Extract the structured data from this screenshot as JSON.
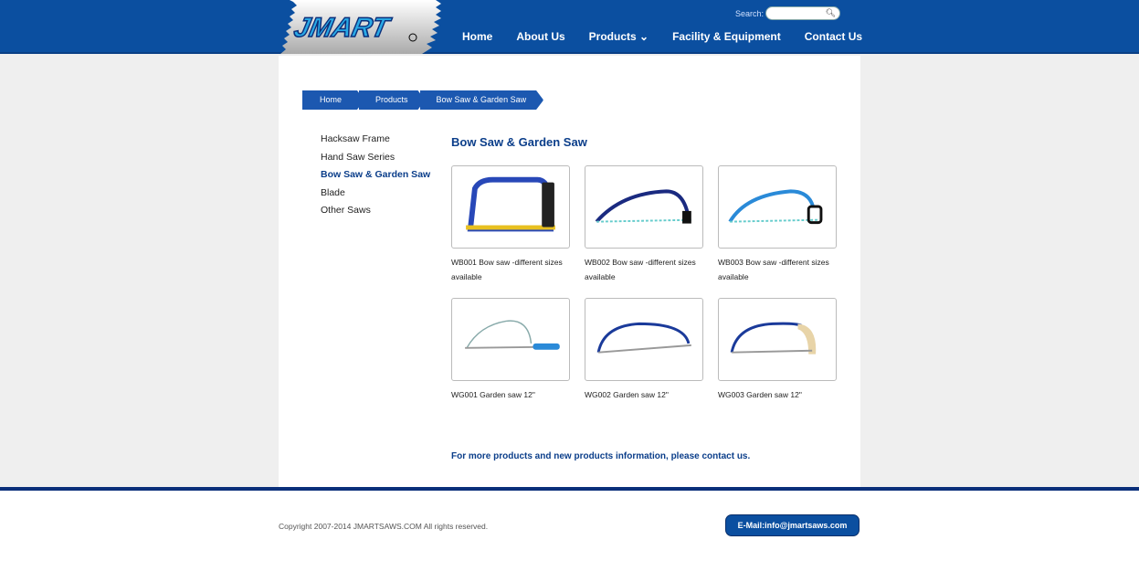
{
  "header": {
    "logo_text": "JMART",
    "search_label": "Search:",
    "search_placeholder": "",
    "nav": [
      "Home",
      "About Us",
      "Products ⌄",
      "Facility & Equipment",
      "Contact Us"
    ]
  },
  "breadcrumb": [
    "Home",
    "Products",
    "Bow Saw & Garden Saw"
  ],
  "sidebar": {
    "items": [
      "Hacksaw Frame",
      "Hand Saw Series",
      "Bow Saw & Garden Saw",
      "Blade",
      "Other Saws"
    ],
    "active": 2
  },
  "main": {
    "title": "Bow Saw & Garden Saw",
    "products": [
      {
        "caption": "WB001 Bow saw -different sizes available"
      },
      {
        "caption": "WB002 Bow saw -different sizes available"
      },
      {
        "caption": "WB003 Bow saw -different sizes available"
      },
      {
        "caption": "WG001 Garden saw 12\""
      },
      {
        "caption": "WG002 Garden saw 12\""
      },
      {
        "caption": "WG003 Garden saw 12\""
      }
    ],
    "more": "For more products and new products information, please contact us."
  },
  "footer": {
    "copyright": "Copyright 2007-2014 JMARTSAWS.COM All rights reserved.",
    "email": "E-Mail:info@jmartsaws.com"
  },
  "colors": {
    "brand": "#0b4fa0",
    "title": "#0b3e8a"
  }
}
